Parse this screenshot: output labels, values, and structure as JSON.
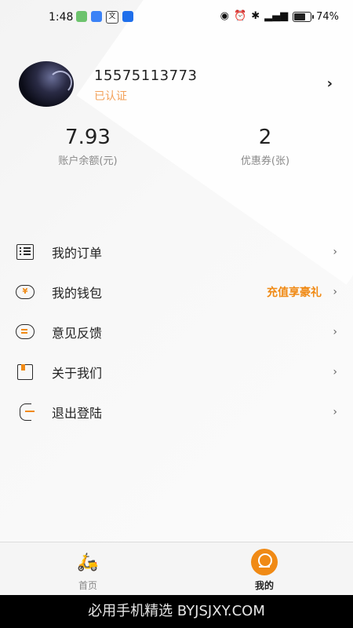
{
  "status_bar": {
    "time": "1:48",
    "battery": "74%",
    "right_icons": [
      "eye-icon",
      "alarm-icon",
      "bluetooth-icon",
      "signal-icon",
      "battery-icon"
    ],
    "left_icons": [
      "wechat-icon",
      "cloud-icon",
      "translate-icon",
      "app-icon"
    ]
  },
  "profile": {
    "phone": "15575113773",
    "verified_label": "已认证"
  },
  "stats": {
    "balance_value": "7.93",
    "balance_label": "账户余额(元)",
    "coupon_value": "2",
    "coupon_label": "优惠券(张)"
  },
  "menu": {
    "items": [
      {
        "label": "我的订单",
        "icon": "order-list-icon"
      },
      {
        "label": "我的钱包",
        "icon": "wallet-icon",
        "promo": "充值享豪礼"
      },
      {
        "label": "意见反馈",
        "icon": "feedback-icon"
      },
      {
        "label": "关于我们",
        "icon": "about-icon"
      },
      {
        "label": "退出登陆",
        "icon": "logout-icon"
      }
    ]
  },
  "tabbar": {
    "home_label": "首页",
    "mine_label": "我的"
  },
  "watermark": "必用手机精选 BYJSJXY.COM",
  "colors": {
    "accent": "#f08a15",
    "verified": "#f3a15a"
  }
}
